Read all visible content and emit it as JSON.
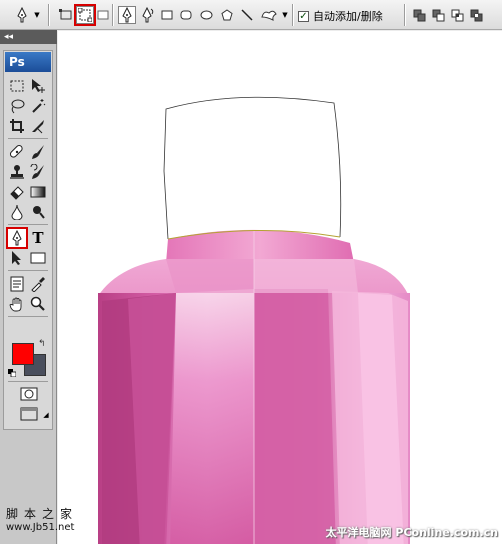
{
  "options_bar": {
    "auto_add_delete_label": "自动添加/删除",
    "auto_add_delete_checked": true,
    "tool_icons": [
      "pen-tool-icon",
      "shape-layers-icon",
      "paths-icon",
      "fill-pixels-icon",
      "pen-icon",
      "freeform-pen-icon",
      "rectangle-icon",
      "rounded-rectangle-icon",
      "ellipse-icon",
      "polygon-icon",
      "line-icon",
      "custom-shape-icon",
      "add-to-path-icon",
      "subtract-from-path-icon",
      "intersect-path-icon",
      "exclude-path-icon"
    ]
  },
  "toolbox": {
    "app_logo": "Ps",
    "collapse_glyph": "◂◂",
    "type_tool_label": "T",
    "foreground_color": "#ff0000",
    "background_color": "#4a4f5d"
  },
  "canvas": {
    "background": "#ffffff",
    "bottle_color": "#d4589f",
    "path_stroke": "#333333"
  },
  "watermarks": {
    "site_cn": "脚本之家",
    "site_url": "www.Jb51.net",
    "pconline": "太平洋电脑网 PConline.com.cn"
  }
}
